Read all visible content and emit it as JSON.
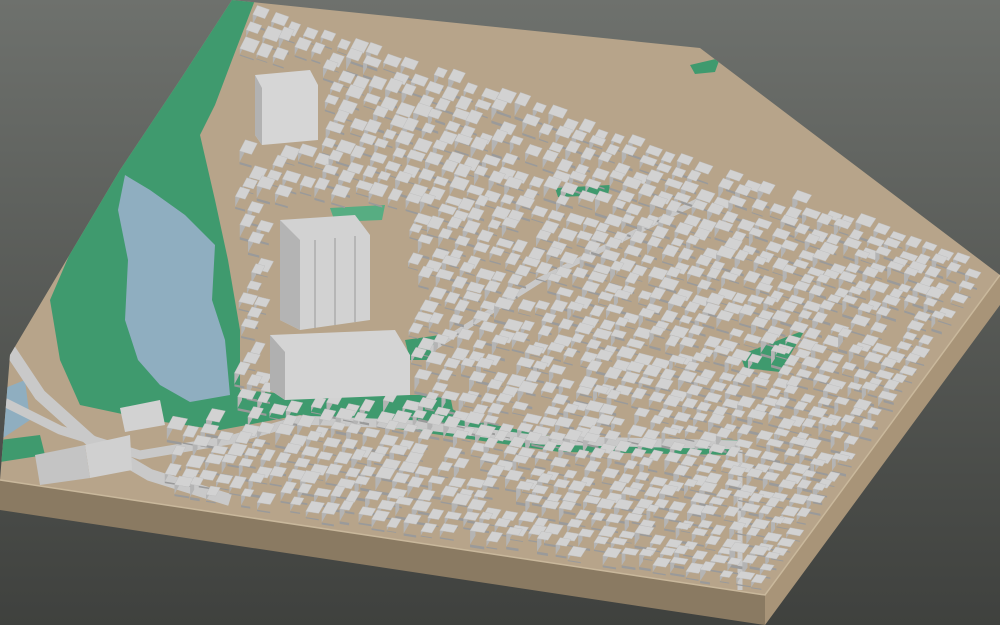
{
  "scene": {
    "kind": "3d-city-block-model",
    "background_top": "#6e716d",
    "background_bottom": "#3f413e",
    "colors": {
      "building": "#d2d2d2",
      "building_shade": "#b4b4b4",
      "building_dark": "#9a9a9a",
      "ground": "#b7a48a",
      "road": "#c9c9c9",
      "park": "#3f9a6e",
      "park_light": "#57ad82",
      "water": "#8faec0",
      "base_side": "#a89478",
      "base_front": "#8a7a62"
    }
  }
}
